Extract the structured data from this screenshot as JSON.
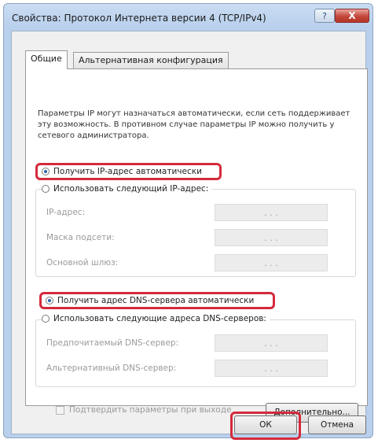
{
  "window": {
    "title": "Свойства: Протокол Интернета версии 4 (TCP/IPv4)",
    "help": "?",
    "close": "X"
  },
  "tabs": [
    {
      "label": "Общие"
    },
    {
      "label": "Альтернативная конфигурация"
    }
  ],
  "description": "Параметры IP могут назначаться автоматически, если сеть поддерживает эту возможность. В противном случае параметры IP можно получить у сетевого администратора.",
  "ip": {
    "auto_label": "Получить IP-адрес автоматически",
    "manual_label": "Использовать следующий IP-адрес:",
    "fields": [
      {
        "label": "IP-адрес:",
        "value": ".   .   ."
      },
      {
        "label": "Маска подсети:",
        "value": ".   .   ."
      },
      {
        "label": "Основной шлюз:",
        "value": ".   .   ."
      }
    ]
  },
  "dns": {
    "auto_label": "Получить адрес DNS-сервера автоматически",
    "manual_label": "Использовать следующие адреса DNS-серверов:",
    "fields": [
      {
        "label": "Предпочитаемый DNS-сервер:",
        "value": ".   .   ."
      },
      {
        "label": "Альтернативный DNS-сервер:",
        "value": ".   .   ."
      }
    ]
  },
  "validate_label": "Подтвердить параметры при выходе",
  "buttons": {
    "advanced": "Дополнительно...",
    "ok": "ОК",
    "cancel": "Отмена"
  },
  "colors": {
    "highlight": "#d42a3c",
    "titlebar": "#b9d0ec"
  }
}
